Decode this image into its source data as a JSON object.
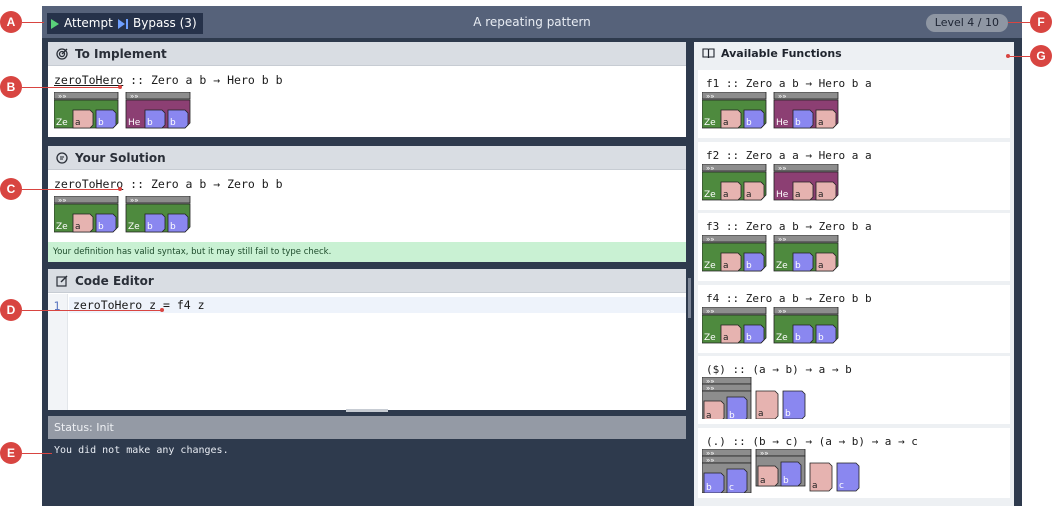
{
  "topbar": {
    "attempt_label": "Attempt",
    "bypass_label": "Bypass (3)",
    "title": "A repeating pattern",
    "level": "Level 4 / 10"
  },
  "to_implement": {
    "header": "To Implement",
    "fn": "zeroToHero",
    "sig": " :: Zero a b → Hero b b"
  },
  "solution": {
    "header": "Your Solution",
    "fn": "zeroToHero",
    "sig": " :: Zero a b → Zero b b",
    "message": "Your definition has valid syntax, but it may still fail to type check."
  },
  "editor": {
    "header": "Code Editor",
    "lines": [
      "zeroToHero z = f4 z"
    ],
    "line_numbers": [
      "1"
    ]
  },
  "status": {
    "header": "Status: Init",
    "message": "You did not make any changes."
  },
  "functions": {
    "header": "Available Functions",
    "items": [
      {
        "sig": "f1 :: Zero a b → Hero b a"
      },
      {
        "sig": "f2 :: Zero a a → Hero a a"
      },
      {
        "sig": "f3 :: Zero a b → Zero b a"
      },
      {
        "sig": "f4 :: Zero a b → Zero b b"
      },
      {
        "sig": "($) :: (a → b) → a → b"
      },
      {
        "sig": "(.) :: (b → c) → (a → b) → a → c"
      }
    ]
  },
  "glyphs": {
    "arrows": "»»",
    "ze": "Ze",
    "he": "He",
    "a": "a",
    "b": "b",
    "c": "c"
  },
  "colors": {
    "zero": "#4e8a3e",
    "hero": "#8c3f73",
    "a": "#e6b3b0",
    "b": "#8a87f0",
    "c": "#8a87f0",
    "arrow_bar": "#8d8d8d",
    "app_bg": "#2e3a4d",
    "topbar_bg": "#56627a",
    "annotation": "#d84541"
  },
  "annotations": [
    "A",
    "B",
    "C",
    "D",
    "E",
    "F",
    "G"
  ]
}
